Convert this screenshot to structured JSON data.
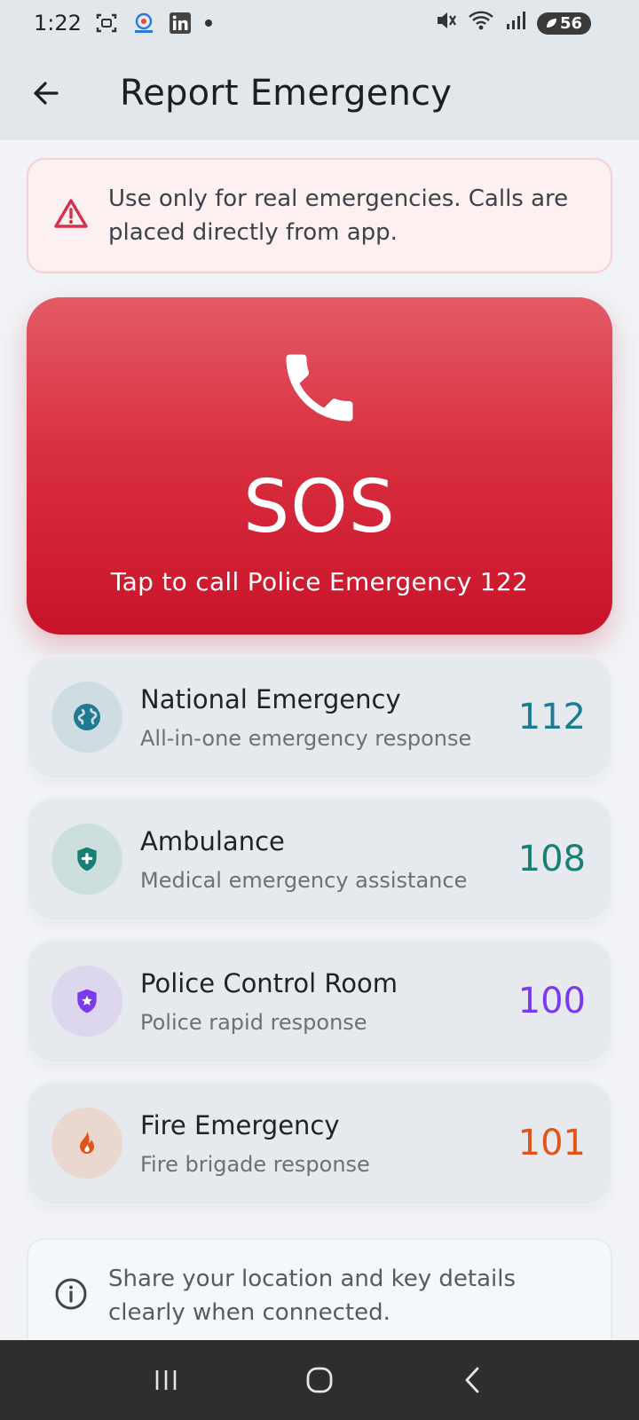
{
  "status_bar": {
    "time": "1:22",
    "battery": "56"
  },
  "app_bar": {
    "title": "Report Emergency"
  },
  "warning": {
    "text": "Use only for real emergencies. Calls are placed directly from app."
  },
  "sos": {
    "title": "SOS",
    "subtitle": "Tap to call Police Emergency 122"
  },
  "contacts": [
    {
      "name": "National Emergency",
      "description": "All-in-one emergency response",
      "number": "112",
      "icon": "globe-icon",
      "color": "#1f7a93",
      "bg": "#cfdde2"
    },
    {
      "name": "Ambulance",
      "description": "Medical emergency assistance",
      "number": "108",
      "icon": "medical-shield-icon",
      "color": "#187f74",
      "bg": "#cddfdc"
    },
    {
      "name": "Police Control Room",
      "description": "Police rapid response",
      "number": "100",
      "icon": "police-badge-icon",
      "color": "#7c3aed",
      "bg": "#ddd6ef"
    },
    {
      "name": "Fire Emergency",
      "description": "Fire brigade response",
      "number": "101",
      "icon": "fire-icon",
      "color": "#e0561a",
      "bg": "#ead8d0"
    }
  ],
  "info": {
    "text": "Share your location and key details clearly when connected."
  },
  "colors": {
    "sos_top": "#e45a67",
    "sos_bottom": "#c9132a",
    "warning_accent": "#d6304a"
  }
}
